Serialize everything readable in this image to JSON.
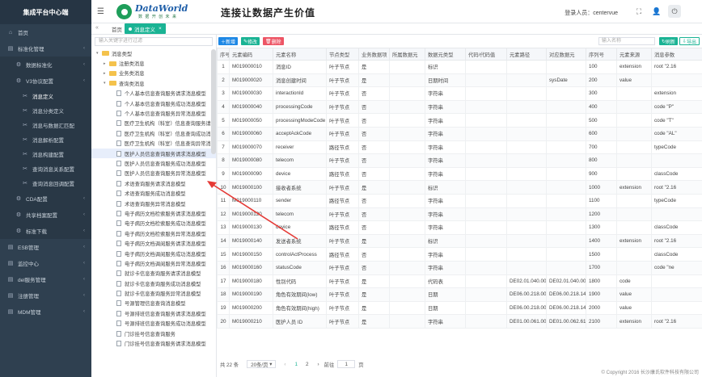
{
  "brand": "集成平台中心端",
  "sidebar": {
    "items": [
      {
        "label": "首页",
        "icon": "home-icon",
        "level": 1
      },
      {
        "label": "标准化管理",
        "icon": "folder-icon",
        "level": 1,
        "chevron": true
      },
      {
        "label": "数据标准化",
        "icon": "gear-icon",
        "level": 2,
        "chevron": true
      },
      {
        "label": "V3协议配置",
        "icon": "gear-icon",
        "level": 2,
        "chevron": true
      },
      {
        "label": "消息定义",
        "icon": "wrench-icon",
        "level": 3,
        "active": true
      },
      {
        "label": "消息分类定义",
        "icon": "wrench-icon",
        "level": 3
      },
      {
        "label": "消息与数据汇匹配",
        "icon": "wrench-icon",
        "level": 3
      },
      {
        "label": "消息解析配置",
        "icon": "wrench-icon",
        "level": 3
      },
      {
        "label": "消息构建配置",
        "icon": "wrench-icon",
        "level": 3
      },
      {
        "label": "查询消息关系配置",
        "icon": "wrench-icon",
        "level": 3
      },
      {
        "label": "查询消息回调配置",
        "icon": "wrench-icon",
        "level": 3
      },
      {
        "label": "CDA配置",
        "icon": "gear-icon",
        "level": 2,
        "chevron": true
      },
      {
        "label": "共享档案配置",
        "icon": "gear-icon",
        "level": 2,
        "chevron": true
      },
      {
        "label": "标准下载",
        "icon": "gear-icon",
        "level": 2,
        "chevron": true
      },
      {
        "label": "ESB管理",
        "icon": "folder-icon",
        "level": 1,
        "chevron": true
      },
      {
        "label": "监控中心",
        "icon": "folder-icon",
        "level": 1,
        "chevron": true
      },
      {
        "label": "del服务管理",
        "icon": "folder-icon",
        "level": 1,
        "chevron": true
      },
      {
        "label": "注册管理",
        "icon": "folder-icon",
        "level": 1,
        "chevron": true
      },
      {
        "label": "MDM管理",
        "icon": "folder-icon",
        "level": 1,
        "chevron": true
      }
    ]
  },
  "header": {
    "logo_text": "DataWorld",
    "logo_sub": "数 据 开 创 未 来",
    "slogan": "连接让数据产生价值",
    "user_label": "登录人员：",
    "user_name": "centervue"
  },
  "tabs": {
    "home": "首页",
    "current": "消息定义"
  },
  "tree": {
    "search_placeholder": "输入关键字进行过滤",
    "nodes": [
      {
        "label": "消息类型",
        "kind": "folder",
        "indent": 0,
        "toggle": "▾"
      },
      {
        "label": "注册类消息",
        "kind": "folder",
        "indent": 1,
        "toggle": "▸"
      },
      {
        "label": "业务类消息",
        "kind": "folder",
        "indent": 1,
        "toggle": "▸"
      },
      {
        "label": "查询类消息",
        "kind": "folder",
        "indent": 1,
        "toggle": "▾"
      },
      {
        "label": "个人基本信息查询服务请求消息模型",
        "kind": "doc",
        "indent": 2
      },
      {
        "label": "个人基本信息查询服务成功消息模型",
        "kind": "doc",
        "indent": 2
      },
      {
        "label": "个人基本信息查询服务异常消息模型",
        "kind": "doc",
        "indent": 2
      },
      {
        "label": "医疗卫生机构（科室）信息查询服务请求",
        "kind": "doc",
        "indent": 2
      },
      {
        "label": "医疗卫生机构（科室）信息查询成功消息",
        "kind": "doc",
        "indent": 2
      },
      {
        "label": "医疗卫生机构（科室）信息查询异常消息",
        "kind": "doc",
        "indent": 2
      },
      {
        "label": "医护人员信息查询服务请求消息模型",
        "kind": "doc",
        "indent": 2,
        "selected": true
      },
      {
        "label": "医护人员信息查询服务成功消息模型",
        "kind": "doc",
        "indent": 2
      },
      {
        "label": "医护人员信息查询服务异常消息模型",
        "kind": "doc",
        "indent": 2
      },
      {
        "label": "术语查询服务请求消息模型",
        "kind": "doc",
        "indent": 2
      },
      {
        "label": "术语查询服务成功消息模型",
        "kind": "doc",
        "indent": 2
      },
      {
        "label": "术语查询服务异常消息模型",
        "kind": "doc",
        "indent": 2
      },
      {
        "label": "电子病历文档检索服务请求消息模型",
        "kind": "doc",
        "indent": 2
      },
      {
        "label": "电子病历文档检索服务成功消息模型",
        "kind": "doc",
        "indent": 2
      },
      {
        "label": "电子病历文档检索服务异常消息模型",
        "kind": "doc",
        "indent": 2
      },
      {
        "label": "电子病历文档调阅服务请求消息模型",
        "kind": "doc",
        "indent": 2
      },
      {
        "label": "电子病历文档调阅服务成功消息模型",
        "kind": "doc",
        "indent": 2
      },
      {
        "label": "电子病历文档调阅服务异常消息模型",
        "kind": "doc",
        "indent": 2
      },
      {
        "label": "就诊卡信息查询服务请求消息模型",
        "kind": "doc",
        "indent": 2
      },
      {
        "label": "就诊卡信息查询服务成功消息模型",
        "kind": "doc",
        "indent": 2
      },
      {
        "label": "就诊卡信息查询服务异常消息模型",
        "kind": "doc",
        "indent": 2
      },
      {
        "label": "号源管理信息查询消息模型",
        "kind": "doc",
        "indent": 2
      },
      {
        "label": "号源排班信息查询服务请求消息模型",
        "kind": "doc",
        "indent": 2
      },
      {
        "label": "号源排班信息查询服务成功消息模型",
        "kind": "doc",
        "indent": 2
      },
      {
        "label": "门诊挂号信息查询服务",
        "kind": "doc",
        "indent": 2
      },
      {
        "label": "门诊挂号信息查询服务请求消息模型",
        "kind": "doc",
        "indent": 2
      }
    ]
  },
  "toolbar": {
    "add": "新增",
    "edit": "修改",
    "delete": "删除",
    "search_placeholder": "输入名称",
    "refresh": "刷新",
    "export": "导出"
  },
  "table": {
    "columns": [
      "序号",
      "元素编码",
      "元素名称",
      "节点类型",
      "业务数据项",
      "所属数据元",
      "数据元类型",
      "代码/代码值",
      "元素路径",
      "对应数据元",
      "序列号",
      "元素来源",
      "消息参数"
    ],
    "rows": [
      [
        "1",
        "M019000010",
        "消息ID",
        "叶子节点",
        "是",
        "",
        "标识",
        "",
        "",
        "",
        "100",
        "extension",
        "root \"2.16"
      ],
      [
        "2",
        "M019000020",
        "消息创建时间",
        "叶子节点",
        "是",
        "",
        "日期时间",
        "",
        "",
        "sysDate",
        "200",
        "value",
        ""
      ],
      [
        "3",
        "M019000030",
        "interactionId",
        "叶子节点",
        "否",
        "",
        "字符串",
        "",
        "",
        "",
        "300",
        "",
        "extension"
      ],
      [
        "4",
        "M019000040",
        "processingCode",
        "叶子节点",
        "否",
        "",
        "字符串",
        "",
        "",
        "",
        "400",
        "",
        "code \"P\""
      ],
      [
        "5",
        "M019000050",
        "processingModeCode",
        "叶子节点",
        "否",
        "",
        "字符串",
        "",
        "",
        "",
        "500",
        "",
        "code \"T\""
      ],
      [
        "6",
        "M019000060",
        "acceptAckCode",
        "叶子节点",
        "否",
        "",
        "字符串",
        "",
        "",
        "",
        "600",
        "",
        "code \"AL\""
      ],
      [
        "7",
        "M019000070",
        "receiver",
        "路径节点",
        "否",
        "",
        "字符串",
        "",
        "",
        "",
        "700",
        "",
        "typeCode"
      ],
      [
        "8",
        "M019000080",
        "telecom",
        "叶子节点",
        "否",
        "",
        "字符串",
        "",
        "",
        "",
        "800",
        "",
        ""
      ],
      [
        "9",
        "M019000090",
        "device",
        "路径节点",
        "否",
        "",
        "字符串",
        "",
        "",
        "",
        "900",
        "",
        "classCode"
      ],
      [
        "10",
        "M019000100",
        "接收者系统",
        "叶子节点",
        "是",
        "",
        "标识",
        "",
        "",
        "",
        "1000",
        "extension",
        "root \"2.16"
      ],
      [
        "11",
        "M019000110",
        "sender",
        "路径节点",
        "否",
        "",
        "字符串",
        "",
        "",
        "",
        "1100",
        "",
        "typeCode"
      ],
      [
        "12",
        "M019000120",
        "telecom",
        "叶子节点",
        "否",
        "",
        "字符串",
        "",
        "",
        "",
        "1200",
        "",
        ""
      ],
      [
        "13",
        "M019000130",
        "device",
        "路径节点",
        "否",
        "",
        "字符串",
        "",
        "",
        "",
        "1300",
        "",
        "classCode"
      ],
      [
        "14",
        "M019000140",
        "发送者系统",
        "叶子节点",
        "是",
        "",
        "标识",
        "",
        "",
        "",
        "1400",
        "extension",
        "root \"2.16"
      ],
      [
        "15",
        "M019000150",
        "controlActProcess",
        "路径节点",
        "否",
        "",
        "字符串",
        "",
        "",
        "",
        "1500",
        "",
        "classCode"
      ],
      [
        "16",
        "M019000160",
        "statusCode",
        "叶子节点",
        "否",
        "",
        "字符串",
        "",
        "",
        "",
        "1700",
        "",
        "code \"ne"
      ],
      [
        "17",
        "M019000180",
        "性别代码",
        "叶子节点",
        "是",
        "",
        "代码表",
        "",
        "DE02.01.040.00",
        "DE02.01.040.00",
        "1800",
        "code",
        ""
      ],
      [
        "18",
        "M019000190",
        "角色有效期间(low)",
        "叶子节点",
        "是",
        "",
        "日期",
        "",
        "DE06.00.218.00",
        "DE06.00.218.14",
        "1900",
        "value",
        ""
      ],
      [
        "19",
        "M019000200",
        "角色有效期间(high)",
        "叶子节点",
        "是",
        "",
        "日期",
        "",
        "DE06.00.218.00",
        "DE06.00.218.14",
        "2000",
        "value",
        ""
      ],
      [
        "20",
        "M019000210",
        "医护人员 ID",
        "叶子节点",
        "是",
        "",
        "字符串",
        "",
        "DE01.00.061.00",
        "DE01.00.062.61",
        "2100",
        "extension",
        "root \"2.16"
      ]
    ]
  },
  "pager": {
    "total": "共 22 条",
    "per_page": "20条/页",
    "prev": "‹",
    "page1": "1",
    "page2": "2",
    "next": "›",
    "goto": "前往",
    "goto_value": "1",
    "page_unit": "页"
  },
  "footer": "© Copyright 2016 长沙康氏软件科技有限公司",
  "colors": {
    "sidebar": "#2f4050",
    "accent": "#1ab394",
    "add": "#1e88e5",
    "edit": "#1ab394",
    "delete": "#ed5565",
    "annotation": "#e53935"
  }
}
